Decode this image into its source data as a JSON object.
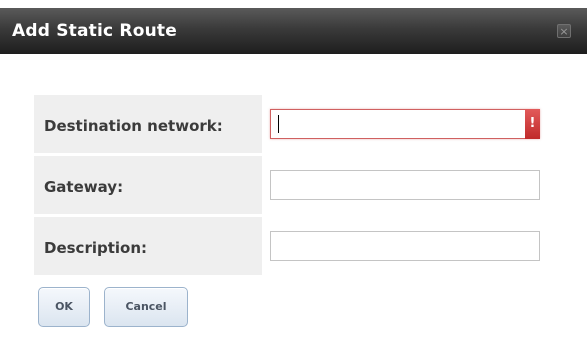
{
  "dialog": {
    "title": "Add Static Route",
    "close_icon": "close-icon"
  },
  "form": {
    "destination": {
      "label": "Destination network:",
      "value": "",
      "error_badge": "!",
      "has_error": true
    },
    "gateway": {
      "label": "Gateway:",
      "value": ""
    },
    "description": {
      "label": "Description:",
      "value": ""
    }
  },
  "actions": {
    "ok_label": "OK",
    "cancel_label": "Cancel"
  },
  "colors": {
    "titlebar": "#2a2a2a",
    "label_bg": "#efefef",
    "error": "#c02a2a",
    "button_border": "#9cb3cc"
  }
}
